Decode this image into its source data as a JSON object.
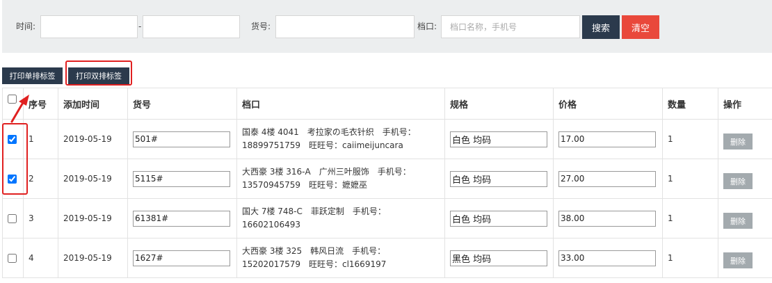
{
  "filter": {
    "time_label": "时间:",
    "time_sep": "-",
    "sku_label": "货号:",
    "stall_label": "档口:",
    "stall_placeholder": "档口名称，手机号",
    "search_label": "搜索",
    "clear_label": "清空"
  },
  "actions": {
    "print_single": "打印单排标签",
    "print_double": "打印双排标签"
  },
  "table": {
    "headers": {
      "index": "序号",
      "added_time": "添加时间",
      "sku": "货号",
      "stall": "档口",
      "spec": "规格",
      "price": "价格",
      "quantity": "数量",
      "action": "操作"
    },
    "delete_label": "删除",
    "rows": [
      {
        "index": "1",
        "date": "2019-05-19",
        "sku": "501#",
        "stall_line1": "国泰 4楼 4041　考拉家の毛衣针织　手机号：",
        "stall_line2": "18899751759　旺旺号：caiimeijuncara",
        "spec": "白色 均码",
        "price": "17.00",
        "qty": "1",
        "checked": true
      },
      {
        "index": "2",
        "date": "2019-05-19",
        "sku": "5115#",
        "stall_line1": "大西豪 3楼 316-A　广州三叶服饰　手机号：",
        "stall_line2": "13570945759　旺旺号：嬷嬷巫",
        "spec": "白色 均码",
        "price": "27.00",
        "qty": "1",
        "checked": true
      },
      {
        "index": "3",
        "date": "2019-05-19",
        "sku": "61381#",
        "stall_line1": "国大 7楼 748-C　菲跃定制　手机号：",
        "stall_line2": "16602106493",
        "spec": "白色 均码",
        "price": "38.00",
        "qty": "1",
        "checked": false
      },
      {
        "index": "4",
        "date": "2019-05-19",
        "sku": "1627#",
        "stall_line1": "大西豪 3楼 325　韩风日流　手机号：",
        "stall_line2": "15202017579　旺旺号：cl1669197",
        "spec": "黑色 均码",
        "price": "33.00",
        "qty": "1",
        "checked": false
      }
    ]
  },
  "colors": {
    "search_button": "#2b3a4c",
    "clear_button": "#e9483b",
    "highlight": "#e02020",
    "delete_button": "#a3aaae"
  }
}
